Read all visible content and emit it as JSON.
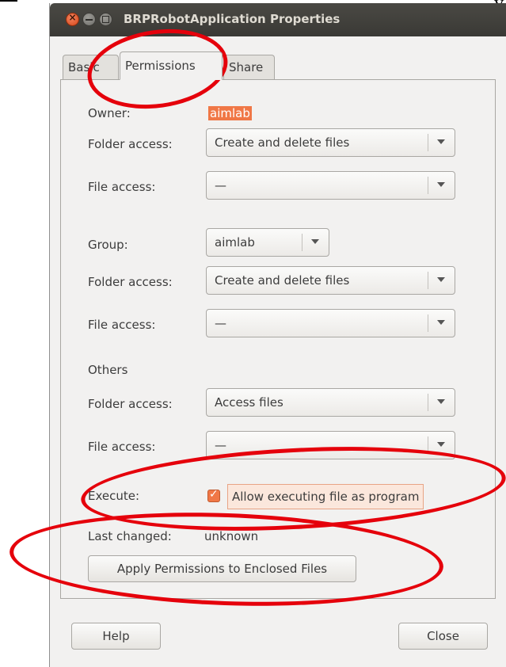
{
  "window": {
    "title": "BRPRobotApplication Properties"
  },
  "tabs": [
    {
      "label": "Basic",
      "selected": false
    },
    {
      "label": "Permissions",
      "selected": true
    },
    {
      "label": "Share",
      "selected": false
    }
  ],
  "owner": {
    "label": "Owner:",
    "value": "aimlab",
    "folder_access": {
      "label": "Folder access:",
      "value": "Create and delete files"
    },
    "file_access": {
      "label": "File access:",
      "value": "—"
    }
  },
  "group": {
    "label": "Group:",
    "value": "aimlab",
    "folder_access": {
      "label": "Folder access:",
      "value": "Create and delete files"
    },
    "file_access": {
      "label": "File access:",
      "value": "—"
    }
  },
  "others": {
    "label": "Others",
    "folder_access": {
      "label": "Folder access:",
      "value": "Access files"
    },
    "file_access": {
      "label": "File access:",
      "value": "—"
    }
  },
  "execute": {
    "label": "Execute:",
    "checkbox_label": "Allow executing file as program",
    "checked": true
  },
  "last_changed": {
    "label": "Last changed:",
    "value": "unknown"
  },
  "buttons": {
    "apply": "Apply Permissions to Enclosed Files",
    "help": "Help",
    "close": "Close"
  },
  "colors": {
    "accent": "#f07746",
    "annotation_red": "#e5000b",
    "titlebar": "#3c3b37",
    "window_bg": "#f2f1f0"
  }
}
